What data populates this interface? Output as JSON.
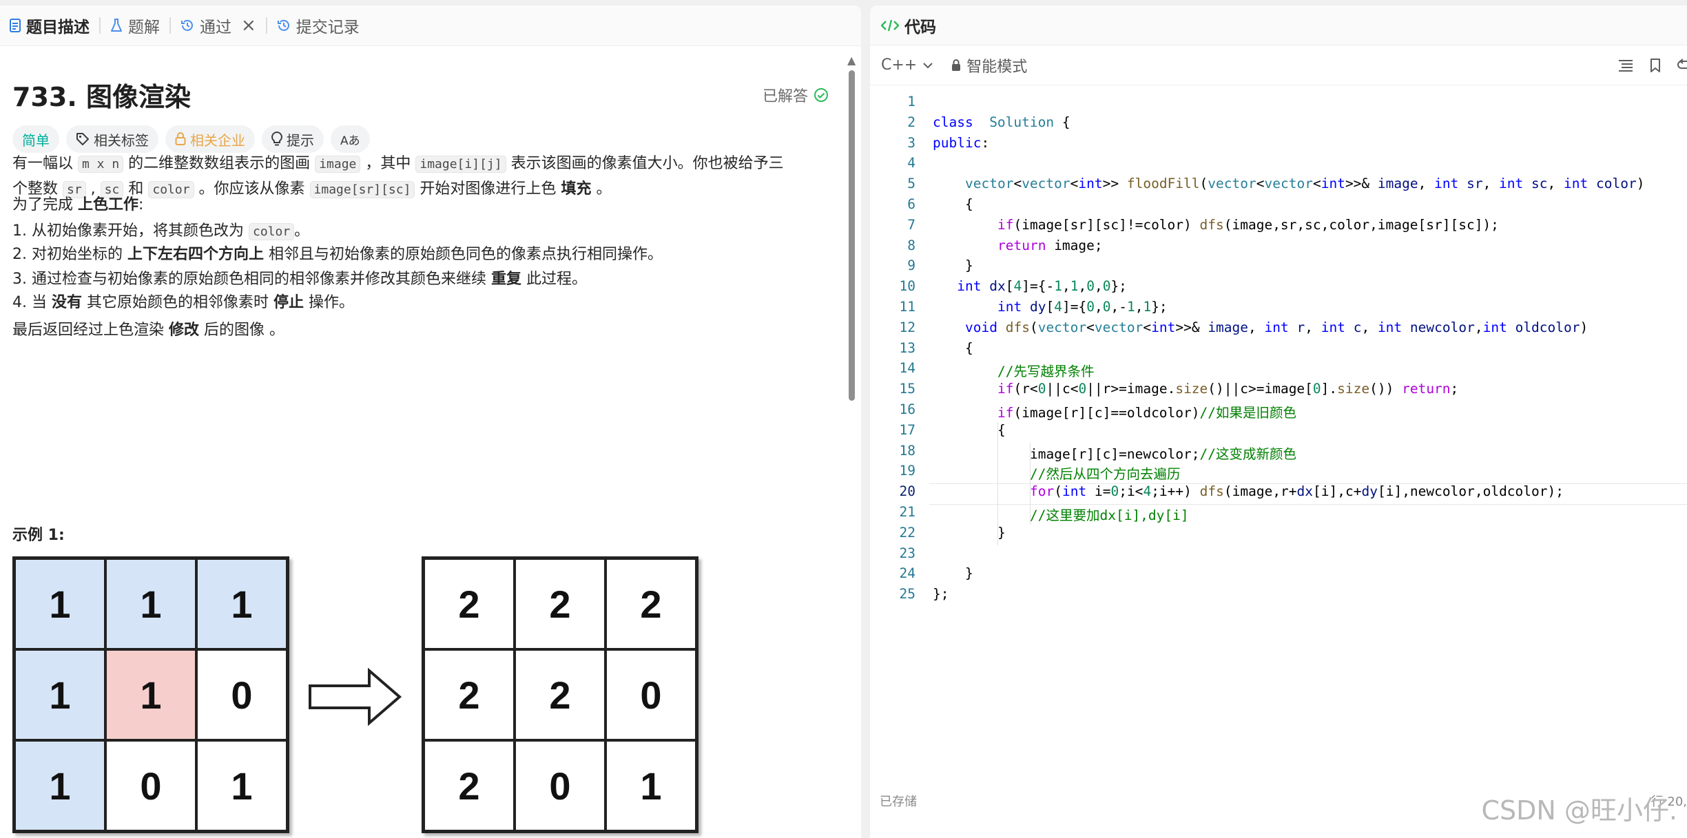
{
  "tabs": {
    "description": "题目描述",
    "solution": "题解",
    "accepted": "通过",
    "submissions": "提交记录"
  },
  "problem": {
    "title": "733. 图像渲染",
    "status": "已解答",
    "tags": {
      "difficulty": "简单",
      "related_tags": "相关标签",
      "companies": "相关企业",
      "hint": "提示",
      "font": "Aあ"
    },
    "p1": {
      "t1": "有一幅以 ",
      "c1": "m x n",
      "t2": " 的二维整数数组表示的图画 ",
      "c2": "image",
      "t3": " ，其中 ",
      "c3": "image[i][j]",
      "t4": " 表示该图画的像素值大小。你也被给予三",
      "t5": "个整数 ",
      "c4": "sr",
      "t6": " , ",
      "c5": "sc",
      "t7": " 和 ",
      "c6": "color",
      "t8": " 。你应该从像素 ",
      "c7": "image[sr][sc]",
      "t9": " 开始对图像进行上色 ",
      "b1": "填充",
      "t10": " 。"
    },
    "p2": {
      "t1": "为了完成 ",
      "b1": "上色工作",
      "t2": ":"
    },
    "steps": {
      "s1": {
        "t1": "1. 从初始像素开始，将其颜色改为 ",
        "c1": "color",
        "t2": "。"
      },
      "s2": {
        "t1": "2. 对初始坐标的 ",
        "b1": "上下左右四个方向上",
        "t2": " 相邻且与初始像素的原始颜色同色的像素点执行相同操作。"
      },
      "s3": {
        "t1": "3. 通过检查与初始像素的原始颜色相同的相邻像素并修改其颜色来继续 ",
        "b1": "重复",
        "t2": " 此过程。"
      },
      "s4": {
        "t1": "4. 当 ",
        "b1": "没有",
        "t2": " 其它原始颜色的相邻像素时 ",
        "b2": "停止",
        "t3": " 操作。"
      }
    },
    "p3": {
      "t1": "最后返回经过上色渲染 ",
      "b1": "修改",
      "t2": " 后的图像 。"
    },
    "example_title": "示例 1:",
    "example": {
      "input": [
        [
          {
            "v": "1",
            "c": "blue"
          },
          {
            "v": "1",
            "c": "blue"
          },
          {
            "v": "1",
            "c": "blue"
          }
        ],
        [
          {
            "v": "1",
            "c": "blue"
          },
          {
            "v": "1",
            "c": "red"
          },
          {
            "v": "0",
            "c": "white"
          }
        ],
        [
          {
            "v": "1",
            "c": "blue"
          },
          {
            "v": "0",
            "c": "white"
          },
          {
            "v": "1",
            "c": "white"
          }
        ]
      ],
      "output": [
        [
          "2",
          "2",
          "2"
        ],
        [
          "2",
          "2",
          "0"
        ],
        [
          "2",
          "0",
          "1"
        ]
      ]
    }
  },
  "code_panel": {
    "header": "代码",
    "language": "C++",
    "mode": "智能模式",
    "saved": "已存储",
    "cursor": "行 20,",
    "current_line": 20,
    "lines": [
      [],
      [
        [
          "kw",
          "class"
        ],
        [
          "",
          "  "
        ],
        [
          "ty",
          "Solution"
        ],
        [
          "",
          " {"
        ]
      ],
      [
        [
          "kw",
          "public"
        ],
        [
          "",
          ":"
        ]
      ],
      [],
      [
        [
          "",
          ""
        ],
        [
          "ty",
          "vector"
        ],
        [
          "",
          "<"
        ],
        [
          "ty",
          "vector"
        ],
        [
          "",
          "<"
        ],
        [
          "kw",
          "int"
        ],
        [
          "",
          ">> "
        ],
        [
          "fn",
          "floodFill"
        ],
        [
          "",
          "("
        ],
        [
          "ty",
          "vector"
        ],
        [
          "",
          "<"
        ],
        [
          "ty",
          "vector"
        ],
        [
          "",
          "<"
        ],
        [
          "kw",
          "int"
        ],
        [
          "",
          ">>& "
        ],
        [
          "id",
          "image"
        ],
        [
          "",
          ", "
        ],
        [
          "kw",
          "int"
        ],
        [
          "",
          " "
        ],
        [
          "id",
          "sr"
        ],
        [
          "",
          ", "
        ],
        [
          "kw",
          "int"
        ],
        [
          "",
          " "
        ],
        [
          "id",
          "sc"
        ],
        [
          "",
          ", "
        ],
        [
          "kw",
          "int"
        ],
        [
          "",
          " "
        ],
        [
          "id",
          "color"
        ],
        [
          "",
          ")"
        ]
      ],
      [
        [
          "",
          "{"
        ]
      ],
      [
        [
          "ct",
          "if"
        ],
        [
          "",
          "(image[sr][sc]!=color) "
        ],
        [
          "fn",
          "dfs"
        ],
        [
          "",
          "(image,sr,sc,color,image[sr][sc]);"
        ]
      ],
      [
        [
          "ct",
          "return"
        ],
        [
          "",
          " image;"
        ]
      ],
      [
        [
          "",
          "}"
        ]
      ],
      [
        [
          "kw",
          "int"
        ],
        [
          "",
          " "
        ],
        [
          "id",
          "dx"
        ],
        [
          "",
          "["
        ],
        [
          "num",
          "4"
        ],
        [
          "",
          "]={-"
        ],
        [
          "num",
          "1"
        ],
        [
          "",
          ","
        ],
        [
          "num",
          "1"
        ],
        [
          "",
          ","
        ],
        [
          "num",
          "0"
        ],
        [
          "",
          ","
        ],
        [
          "num",
          "0"
        ],
        [
          "",
          "};"
        ]
      ],
      [
        [
          "kw",
          "int"
        ],
        [
          "",
          " "
        ],
        [
          "id",
          "dy"
        ],
        [
          "",
          "["
        ],
        [
          "num",
          "4"
        ],
        [
          "",
          "]={"
        ],
        [
          "num",
          "0"
        ],
        [
          "",
          ","
        ],
        [
          "num",
          "0"
        ],
        [
          "",
          ",-"
        ],
        [
          "num",
          "1"
        ],
        [
          "",
          ","
        ],
        [
          "num",
          "1"
        ],
        [
          "",
          "};"
        ]
      ],
      [
        [
          "kw",
          "void"
        ],
        [
          "",
          " "
        ],
        [
          "fn",
          "dfs"
        ],
        [
          "",
          "("
        ],
        [
          "ty",
          "vector"
        ],
        [
          "",
          "<"
        ],
        [
          "ty",
          "vector"
        ],
        [
          "",
          "<"
        ],
        [
          "kw",
          "int"
        ],
        [
          "",
          ">>& "
        ],
        [
          "id",
          "image"
        ],
        [
          "",
          ", "
        ],
        [
          "kw",
          "int"
        ],
        [
          "",
          " "
        ],
        [
          "id",
          "r"
        ],
        [
          "",
          ", "
        ],
        [
          "kw",
          "int"
        ],
        [
          "",
          " "
        ],
        [
          "id",
          "c"
        ],
        [
          "",
          ", "
        ],
        [
          "kw",
          "int"
        ],
        [
          "",
          " "
        ],
        [
          "id",
          "newcolor"
        ],
        [
          "",
          ","
        ],
        [
          "kw",
          "int"
        ],
        [
          "",
          " "
        ],
        [
          "id",
          "oldcolor"
        ],
        [
          "",
          ")"
        ]
      ],
      [
        [
          "",
          "{"
        ]
      ],
      [
        [
          "cm",
          "//先写越界条件"
        ]
      ],
      [
        [
          "ct",
          "if"
        ],
        [
          "",
          "(r<"
        ],
        [
          "num",
          "0"
        ],
        [
          "",
          "||c<"
        ],
        [
          "num",
          "0"
        ],
        [
          "",
          "||r>=image."
        ],
        [
          "fn",
          "size"
        ],
        [
          "",
          "()||c>=image["
        ],
        [
          "num",
          "0"
        ],
        [
          "",
          "]."
        ],
        [
          "fn",
          "size"
        ],
        [
          "",
          "()) "
        ],
        [
          "ct",
          "return"
        ],
        [
          "",
          ";"
        ]
      ],
      [
        [
          "ct",
          "if"
        ],
        [
          "",
          "(image[r][c]==oldcolor)"
        ],
        [
          "cm",
          "//如果是旧颜色"
        ]
      ],
      [
        [
          "",
          "{"
        ]
      ],
      [
        [
          "",
          "image[r][c]=newcolor;"
        ],
        [
          "cm",
          "//这变成新颜色"
        ]
      ],
      [
        [
          "cm",
          "//然后从四个方向去遍历"
        ]
      ],
      [
        [
          "ct",
          "for"
        ],
        [
          "",
          "("
        ],
        [
          "kw",
          "int"
        ],
        [
          "",
          " i="
        ],
        [
          "num",
          "0"
        ],
        [
          "",
          ";i<"
        ],
        [
          "num",
          "4"
        ],
        [
          "",
          ";i++) "
        ],
        [
          "fn",
          "dfs"
        ],
        [
          "",
          "(image,r+"
        ],
        [
          "id",
          "dx"
        ],
        [
          "",
          "[i],c+"
        ],
        [
          "id",
          "dy"
        ],
        [
          "",
          "[i],newcolor,oldcolor);"
        ]
      ],
      [
        [
          "cm",
          "//这里要加dx[i],dy[i]"
        ]
      ],
      [
        [
          "",
          "}"
        ]
      ],
      [],
      [
        [
          "",
          "}"
        ]
      ],
      [
        [
          "",
          "};"
        ]
      ]
    ]
  },
  "watermark": "CSDN @旺小仔."
}
